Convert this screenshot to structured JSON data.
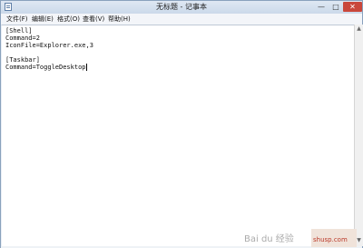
{
  "window": {
    "title": "无标题 - 记事本",
    "buttons": {
      "minimize": "—",
      "maximize": "□",
      "close": "✕"
    }
  },
  "menu": [
    {
      "label": "文件(F)"
    },
    {
      "label": "编辑(E)"
    },
    {
      "label": "格式(O)"
    },
    {
      "label": "查看(V)"
    },
    {
      "label": "帮助(H)"
    }
  ],
  "editor": {
    "lines": [
      "[Shell]",
      "Command=2",
      "IconFile=Explorer.exe,3",
      "",
      "[Taskbar]",
      "Command=ToggleDesktop"
    ]
  },
  "watermark": {
    "brand": "Bai du 经验",
    "site": "shusp.com"
  },
  "icons": {
    "app": "notepad-icon",
    "scroll_up": "chevron-up-icon",
    "scroll_down": "chevron-down-icon"
  },
  "colors": {
    "close_button": "#c9473b",
    "titlebar": "#d3dfed"
  }
}
